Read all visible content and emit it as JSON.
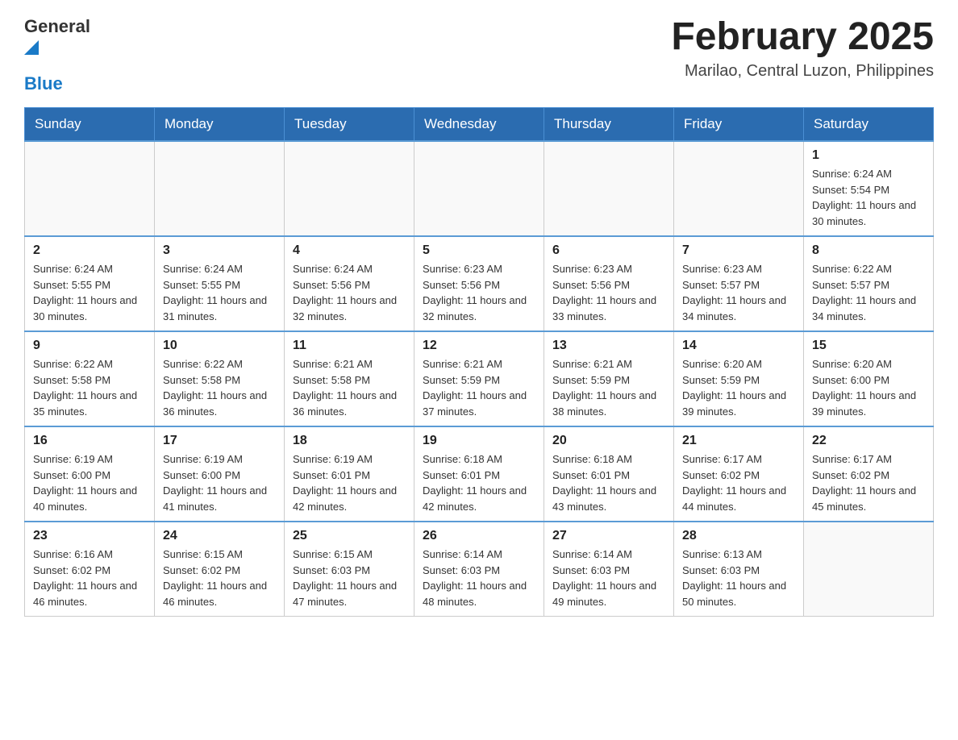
{
  "header": {
    "logo_general": "General",
    "logo_blue": "Blue",
    "month_year": "February 2025",
    "location": "Marilao, Central Luzon, Philippines"
  },
  "days_of_week": [
    "Sunday",
    "Monday",
    "Tuesday",
    "Wednesday",
    "Thursday",
    "Friday",
    "Saturday"
  ],
  "weeks": [
    [
      {
        "day": "",
        "info": ""
      },
      {
        "day": "",
        "info": ""
      },
      {
        "day": "",
        "info": ""
      },
      {
        "day": "",
        "info": ""
      },
      {
        "day": "",
        "info": ""
      },
      {
        "day": "",
        "info": ""
      },
      {
        "day": "1",
        "info": "Sunrise: 6:24 AM\nSunset: 5:54 PM\nDaylight: 11 hours and 30 minutes."
      }
    ],
    [
      {
        "day": "2",
        "info": "Sunrise: 6:24 AM\nSunset: 5:55 PM\nDaylight: 11 hours and 30 minutes."
      },
      {
        "day": "3",
        "info": "Sunrise: 6:24 AM\nSunset: 5:55 PM\nDaylight: 11 hours and 31 minutes."
      },
      {
        "day": "4",
        "info": "Sunrise: 6:24 AM\nSunset: 5:56 PM\nDaylight: 11 hours and 32 minutes."
      },
      {
        "day": "5",
        "info": "Sunrise: 6:23 AM\nSunset: 5:56 PM\nDaylight: 11 hours and 32 minutes."
      },
      {
        "day": "6",
        "info": "Sunrise: 6:23 AM\nSunset: 5:56 PM\nDaylight: 11 hours and 33 minutes."
      },
      {
        "day": "7",
        "info": "Sunrise: 6:23 AM\nSunset: 5:57 PM\nDaylight: 11 hours and 34 minutes."
      },
      {
        "day": "8",
        "info": "Sunrise: 6:22 AM\nSunset: 5:57 PM\nDaylight: 11 hours and 34 minutes."
      }
    ],
    [
      {
        "day": "9",
        "info": "Sunrise: 6:22 AM\nSunset: 5:58 PM\nDaylight: 11 hours and 35 minutes."
      },
      {
        "day": "10",
        "info": "Sunrise: 6:22 AM\nSunset: 5:58 PM\nDaylight: 11 hours and 36 minutes."
      },
      {
        "day": "11",
        "info": "Sunrise: 6:21 AM\nSunset: 5:58 PM\nDaylight: 11 hours and 36 minutes."
      },
      {
        "day": "12",
        "info": "Sunrise: 6:21 AM\nSunset: 5:59 PM\nDaylight: 11 hours and 37 minutes."
      },
      {
        "day": "13",
        "info": "Sunrise: 6:21 AM\nSunset: 5:59 PM\nDaylight: 11 hours and 38 minutes."
      },
      {
        "day": "14",
        "info": "Sunrise: 6:20 AM\nSunset: 5:59 PM\nDaylight: 11 hours and 39 minutes."
      },
      {
        "day": "15",
        "info": "Sunrise: 6:20 AM\nSunset: 6:00 PM\nDaylight: 11 hours and 39 minutes."
      }
    ],
    [
      {
        "day": "16",
        "info": "Sunrise: 6:19 AM\nSunset: 6:00 PM\nDaylight: 11 hours and 40 minutes."
      },
      {
        "day": "17",
        "info": "Sunrise: 6:19 AM\nSunset: 6:00 PM\nDaylight: 11 hours and 41 minutes."
      },
      {
        "day": "18",
        "info": "Sunrise: 6:19 AM\nSunset: 6:01 PM\nDaylight: 11 hours and 42 minutes."
      },
      {
        "day": "19",
        "info": "Sunrise: 6:18 AM\nSunset: 6:01 PM\nDaylight: 11 hours and 42 minutes."
      },
      {
        "day": "20",
        "info": "Sunrise: 6:18 AM\nSunset: 6:01 PM\nDaylight: 11 hours and 43 minutes."
      },
      {
        "day": "21",
        "info": "Sunrise: 6:17 AM\nSunset: 6:02 PM\nDaylight: 11 hours and 44 minutes."
      },
      {
        "day": "22",
        "info": "Sunrise: 6:17 AM\nSunset: 6:02 PM\nDaylight: 11 hours and 45 minutes."
      }
    ],
    [
      {
        "day": "23",
        "info": "Sunrise: 6:16 AM\nSunset: 6:02 PM\nDaylight: 11 hours and 46 minutes."
      },
      {
        "day": "24",
        "info": "Sunrise: 6:15 AM\nSunset: 6:02 PM\nDaylight: 11 hours and 46 minutes."
      },
      {
        "day": "25",
        "info": "Sunrise: 6:15 AM\nSunset: 6:03 PM\nDaylight: 11 hours and 47 minutes."
      },
      {
        "day": "26",
        "info": "Sunrise: 6:14 AM\nSunset: 6:03 PM\nDaylight: 11 hours and 48 minutes."
      },
      {
        "day": "27",
        "info": "Sunrise: 6:14 AM\nSunset: 6:03 PM\nDaylight: 11 hours and 49 minutes."
      },
      {
        "day": "28",
        "info": "Sunrise: 6:13 AM\nSunset: 6:03 PM\nDaylight: 11 hours and 50 minutes."
      },
      {
        "day": "",
        "info": ""
      }
    ]
  ]
}
